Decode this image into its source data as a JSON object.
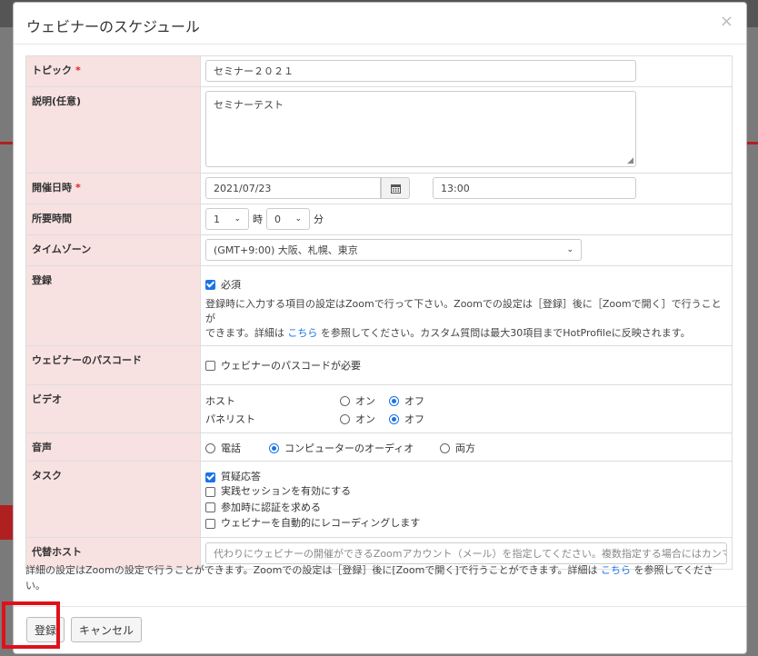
{
  "title": "ウェビナーのスケジュール",
  "close": "×",
  "topic": {
    "label": "トピック",
    "required": "*",
    "value": "セミナー２０２１"
  },
  "description": {
    "label": "説明(任意)",
    "value": "セミナーテスト"
  },
  "datetime": {
    "label": "開催日時",
    "required": "*",
    "date": "2021/07/23",
    "time": "13:00",
    "calendar_icon": "calendar-icon"
  },
  "duration": {
    "label": "所要時間",
    "hours": "1",
    "hours_unit": "時",
    "minutes": "0",
    "minutes_unit": "分"
  },
  "timezone": {
    "label": "タイムゾーン",
    "value": "(GMT+9:00) 大阪、札幌、東京"
  },
  "registration": {
    "label": "登録",
    "checkbox_label": "必須",
    "checked": true,
    "note_line1": "登録時に入力する項目の設定はZoomで行って下さい。Zoomでの設定は［登録］後に［Zoomで開く］で行うことが",
    "note_line2_a": "できます。詳細は",
    "note_link": "こちら",
    "note_line2_b": "を参照してください。カスタム質問は最大30項目までHotProfileに反映されます。"
  },
  "passcode": {
    "label": "ウェビナーのパスコード",
    "checkbox_label": "ウェビナーのパスコードが必要",
    "checked": false
  },
  "video": {
    "label": "ビデオ",
    "host_label": "ホスト",
    "panelist_label": "パネリスト",
    "on": "オン",
    "off": "オフ",
    "host_value": "オフ",
    "panelist_value": "オフ"
  },
  "audio": {
    "label": "音声",
    "options": [
      "電話",
      "コンピューターのオーディオ",
      "両方"
    ],
    "selected": "コンピューターのオーディオ"
  },
  "tasks": {
    "label": "タスク",
    "items": [
      {
        "label": "質疑応答",
        "checked": true
      },
      {
        "label": "実践セッションを有効にする",
        "checked": false
      },
      {
        "label": "参加時に認証を求める",
        "checked": false
      },
      {
        "label": "ウェビナーを自動的にレコーディングします",
        "checked": false
      }
    ]
  },
  "alt_host": {
    "label": "代替ホスト",
    "placeholder": "代わりにウェビナーの開催ができるZoomアカウント（メール）を指定してください。複数指定する場合にはカンマ区切り"
  },
  "footer": {
    "note_a": "詳細の設定はZoomの設定で行うことができます。Zoomでの設定は［登録］後に[Zoomで開く]で行うことができます。詳細は",
    "note_link": "こちら",
    "note_b": "を参照してください。",
    "register_button": "登録",
    "cancel_button": "キャンセル"
  },
  "colors": {
    "label_bg": "#f8e1e1",
    "accent": "#1a73e8",
    "required": "#e02020",
    "highlight": "#e0101a"
  }
}
